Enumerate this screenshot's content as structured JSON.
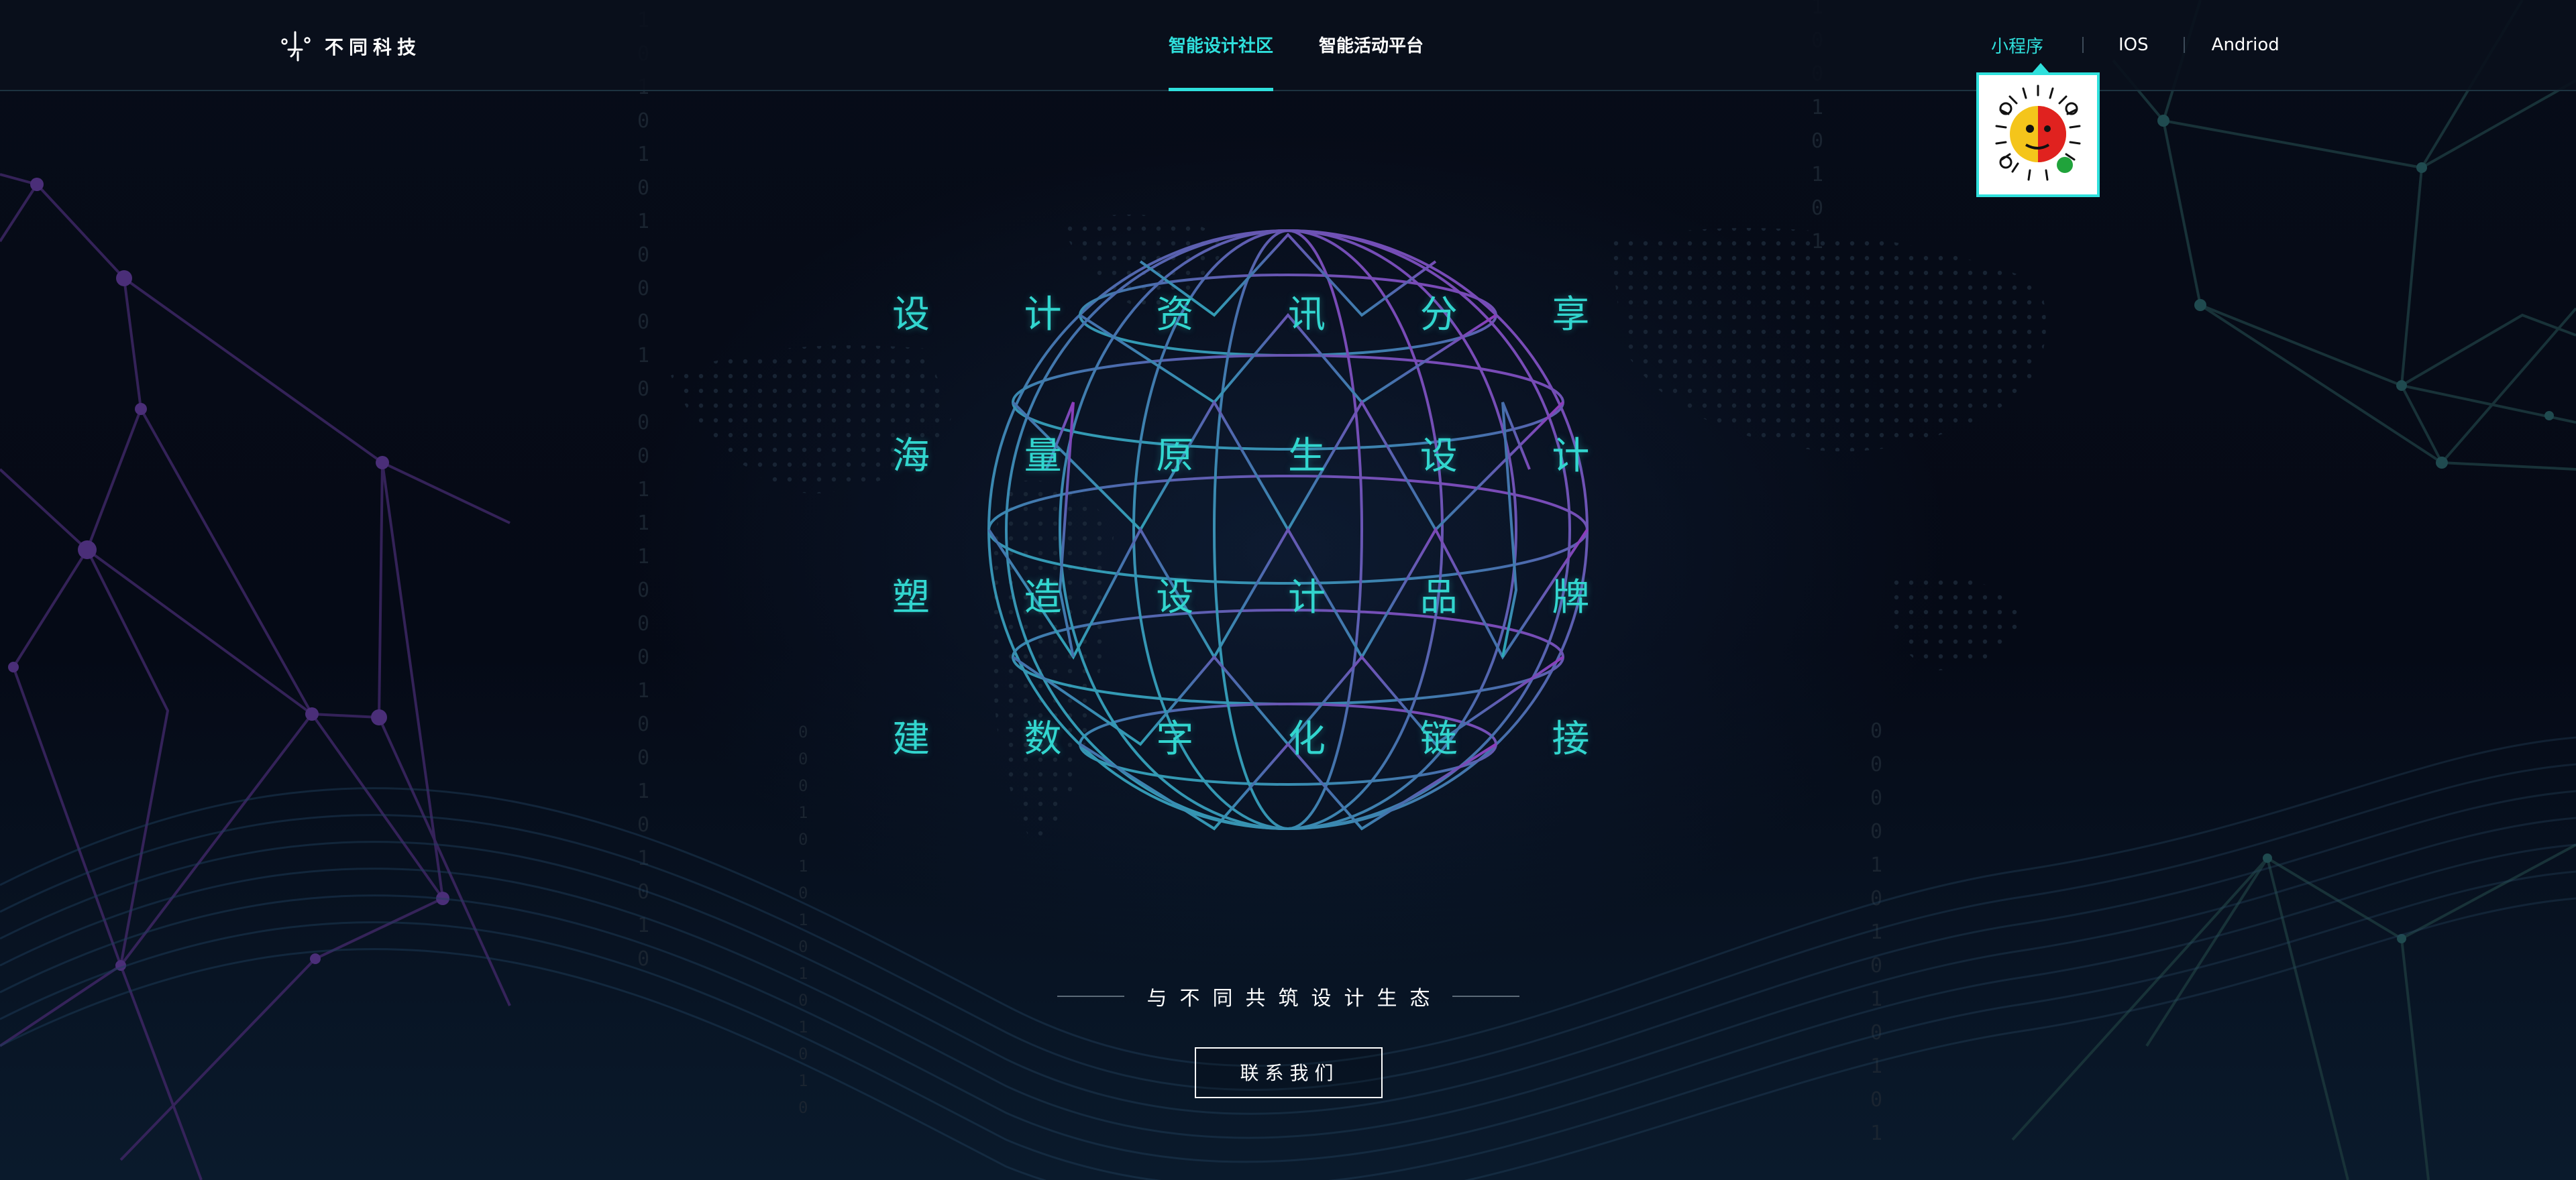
{
  "header": {
    "logo_text": "不同科技",
    "nav": [
      {
        "label": "智能设计社区",
        "active": true
      },
      {
        "label": "智能活动平台",
        "active": false
      }
    ],
    "right_links": [
      {
        "label": "小程序",
        "active": true
      },
      {
        "label": "IOS",
        "active": false
      },
      {
        "label": "Andriod",
        "active": false
      }
    ]
  },
  "main": {
    "grid": [
      [
        "设",
        "计",
        "资",
        "讯",
        "分",
        "享"
      ],
      [
        "海",
        "量",
        "原",
        "生",
        "设",
        "计"
      ],
      [
        "塑",
        "造",
        "设",
        "计",
        "品",
        "牌"
      ],
      [
        "建",
        "数",
        "字",
        "化",
        "链",
        "接"
      ]
    ],
    "tagline": "与不同共筑设计生态",
    "contact_label": "联系我们"
  },
  "colors": {
    "accent": "#2fe0dc",
    "background": "#060b17",
    "sphere_start": "#2fb9c4",
    "sphere_end": "#9b3fc9"
  },
  "icons": [
    "logo-icon",
    "qr-code-icon"
  ]
}
